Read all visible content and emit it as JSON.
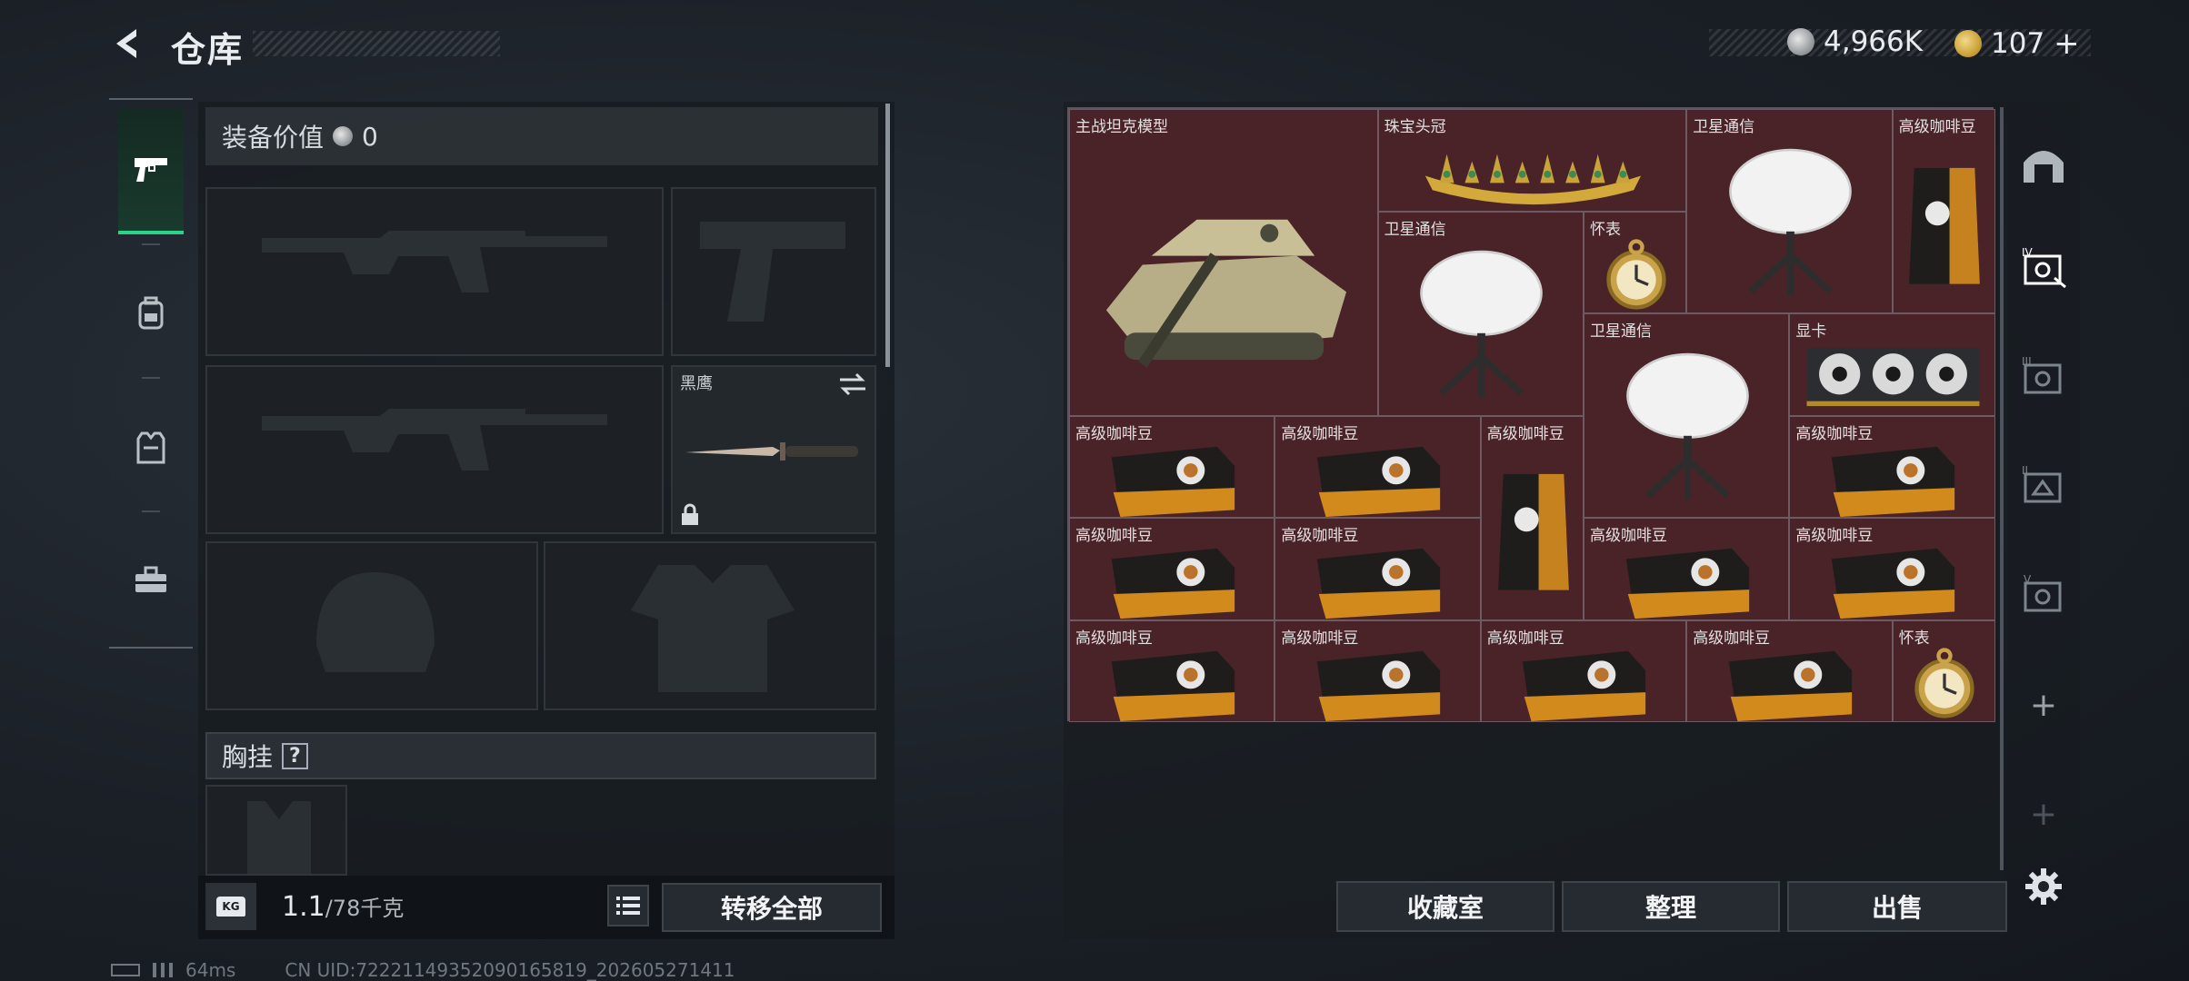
{
  "header": {
    "title": "仓库",
    "silver_amount": "4,966K",
    "gold_amount": "107",
    "gold_plus": "+"
  },
  "nav": {
    "items": [
      {
        "name": "weapons",
        "active": true
      },
      {
        "name": "backpack",
        "active": false
      },
      {
        "name": "vest",
        "active": false
      },
      {
        "name": "toolbox",
        "active": false
      }
    ]
  },
  "equipment": {
    "value_label": "装备价值",
    "value_amount": "0",
    "knife_label": "黑鹰",
    "chest_rig_label": "胸挂",
    "chest_rig_help": "?",
    "weight_current": "1.1",
    "weight_max": "/78千克",
    "weight_icon_text": "KG",
    "transfer_all": "转移全部"
  },
  "storage": {
    "cells": [
      {
        "label": "主战坦克模型",
        "item": "tank"
      },
      {
        "label": "珠宝头冠",
        "item": "tiara"
      },
      {
        "label": "卫星通信",
        "item": "satellite"
      },
      {
        "label": "高级咖啡豆",
        "item": "coffee-bag"
      },
      {
        "label": "卫星通信",
        "item": "satellite"
      },
      {
        "label": "怀表",
        "item": "pocket-watch"
      },
      {
        "label": "卫星通信",
        "item": "satellite"
      },
      {
        "label": "显卡",
        "item": "gpu"
      },
      {
        "label": "高级咖啡豆",
        "item": "coffee-box"
      },
      {
        "label": "高级咖啡豆",
        "item": "coffee-box"
      },
      {
        "label": "高级咖啡豆",
        "item": "coffee-bag"
      },
      {
        "label": "高级咖啡豆",
        "item": "coffee-box"
      },
      {
        "label": "高级咖啡豆",
        "item": "coffee-box"
      },
      {
        "label": "高级咖啡豆",
        "item": "coffee-box"
      },
      {
        "label": "高级咖啡豆",
        "item": "coffee-box"
      },
      {
        "label": "高级咖啡豆",
        "item": "coffee-box"
      },
      {
        "label": "高级咖啡豆",
        "item": "coffee-box"
      },
      {
        "label": "高级咖啡豆",
        "item": "coffee-box"
      },
      {
        "label": "高级咖啡豆",
        "item": "coffee-box"
      },
      {
        "label": "高级咖啡豆",
        "item": "coffee-box"
      },
      {
        "label": "怀表",
        "item": "pocket-watch"
      }
    ],
    "buttons": {
      "collection": "收藏室",
      "sort": "整理",
      "sell": "出售"
    },
    "side_tabs": [
      "home",
      "IV",
      "III",
      "II",
      "V",
      "add",
      "add",
      "settings"
    ]
  },
  "status_bar": {
    "ping": "64ms",
    "uid": "CN UID:7222114935209016581​9_202605271411"
  },
  "colors": {
    "accent_green": "#2bd38a",
    "storage_bg": "#4a2328"
  }
}
